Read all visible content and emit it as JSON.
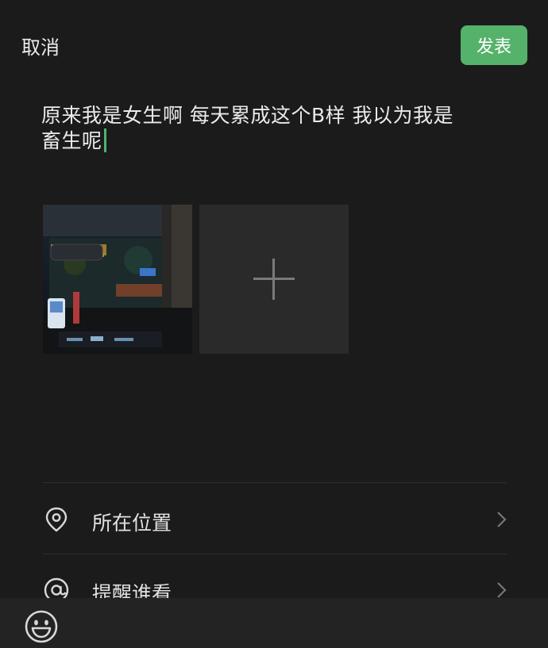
{
  "header": {
    "cancel_label": "取消",
    "publish_label": "发表"
  },
  "post": {
    "text_line1": "原来我是女生啊 每天累成这个B样 我以为我是",
    "text_line2": "畜生呢"
  },
  "media": {
    "photo": "car-interior-night-photo",
    "add_icon": "plus-icon"
  },
  "options": [
    {
      "icon": "location-pin-icon",
      "label": "所在位置"
    },
    {
      "icon": "at-icon",
      "label": "提醒谁看"
    }
  ],
  "bottom": {
    "emoji_icon": "smiley-icon"
  },
  "colors": {
    "background": "#1b1b1b",
    "accent": "#55b26a",
    "caret": "#4fb36c",
    "tile": "#2a2a2a"
  }
}
